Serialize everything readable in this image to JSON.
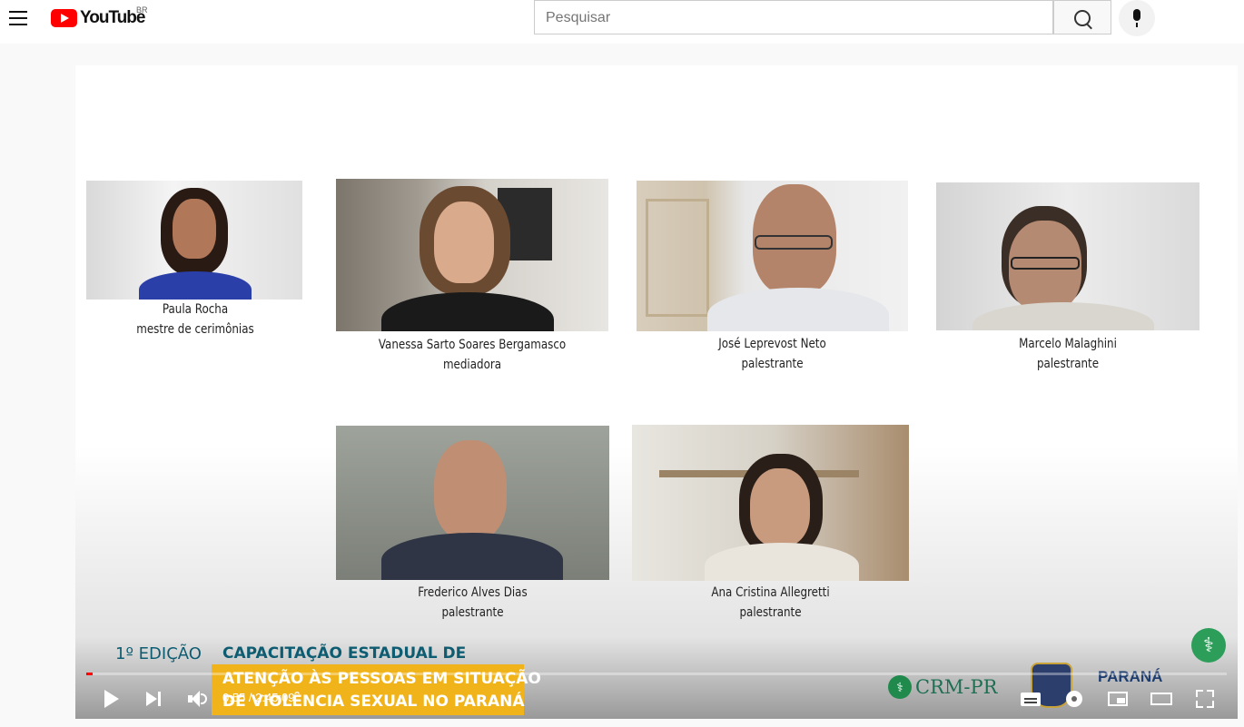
{
  "header": {
    "logo_text": "YouTube",
    "country_code": "BR",
    "search_placeholder": "Pesquisar"
  },
  "video": {
    "participants": [
      {
        "name": "Paula Rocha",
        "role": "mestre de cerimônias"
      },
      {
        "name": "Vanessa Sarto Soares Bergamasco",
        "role": "mediadora"
      },
      {
        "name": "José Leprevost Neto",
        "role": "palestrante"
      },
      {
        "name": "Marcelo Malaghini",
        "role": "palestrante"
      },
      {
        "name": "Frederico Alves Dias",
        "role": "palestrante"
      },
      {
        "name": "Ana Cristina Allegretti",
        "role": "palestrante"
      }
    ],
    "event": {
      "edition": "1º EDIÇÃO",
      "title_line1": "CAPACITAÇÃO ESTADUAL DE",
      "title_line2": "ATENÇÃO ÀS PESSOAS EM SITUAÇÃO",
      "title_line3": "DE VIOLÊNCIA SEXUAL NO PARANÁ"
    },
    "logos": {
      "crm": "CRM-PR",
      "parana": "PARANÁ"
    },
    "brand_colors": {
      "youtube_red": "#ff0000",
      "event_teal": "#0d5c71",
      "event_yellow": "#f0b41a"
    }
  },
  "player": {
    "time_display": "0:55 / 2:45:09",
    "progress_fraction": 0.0055
  }
}
